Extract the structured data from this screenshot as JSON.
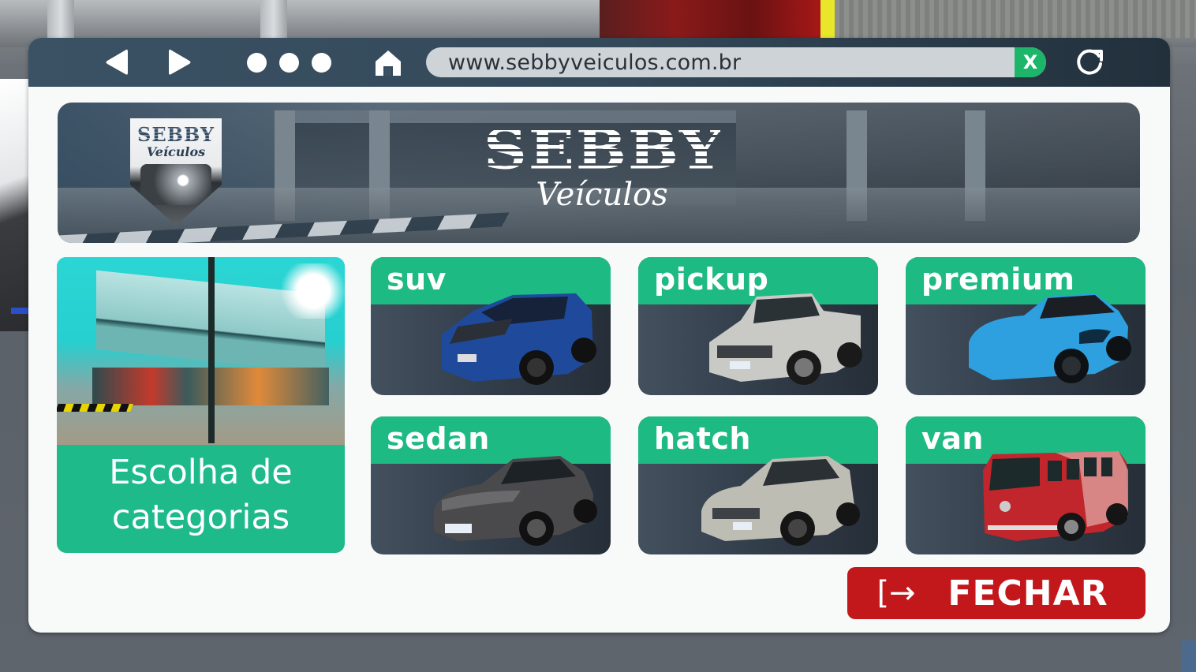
{
  "browser": {
    "url": "www.sebbyveiculos.com.br",
    "clear_label": "X",
    "icons": {
      "back": "back-arrow-icon",
      "forward": "forward-arrow-icon",
      "more": "more-dots-icon",
      "home": "home-icon",
      "clear": "clear-url-icon",
      "reload": "reload-icon"
    }
  },
  "banner": {
    "logo_title": "SEBBY",
    "logo_subtitle": "Veículos",
    "brand_title": "SEBBY",
    "brand_subtitle": "Veículos"
  },
  "intro_card": {
    "label": "Escolha de categorias"
  },
  "categories": [
    {
      "label": "suv",
      "vehicle_color": "#1f4a9c"
    },
    {
      "label": "pickup",
      "vehicle_color": "#c9c9c6"
    },
    {
      "label": "premium",
      "vehicle_color": "#2ea0e0"
    },
    {
      "label": "sedan",
      "vehicle_color": "#4a4a4c"
    },
    {
      "label": "hatch",
      "vehicle_color": "#bdbdb4"
    },
    {
      "label": "van",
      "vehicle_color": "#c0262b"
    }
  ],
  "close_button": {
    "icon": "[→",
    "label": "FECHAR"
  },
  "colors": {
    "accent_green": "#1dba84",
    "toolbar": "#34495a",
    "close_red": "#c2181b"
  }
}
